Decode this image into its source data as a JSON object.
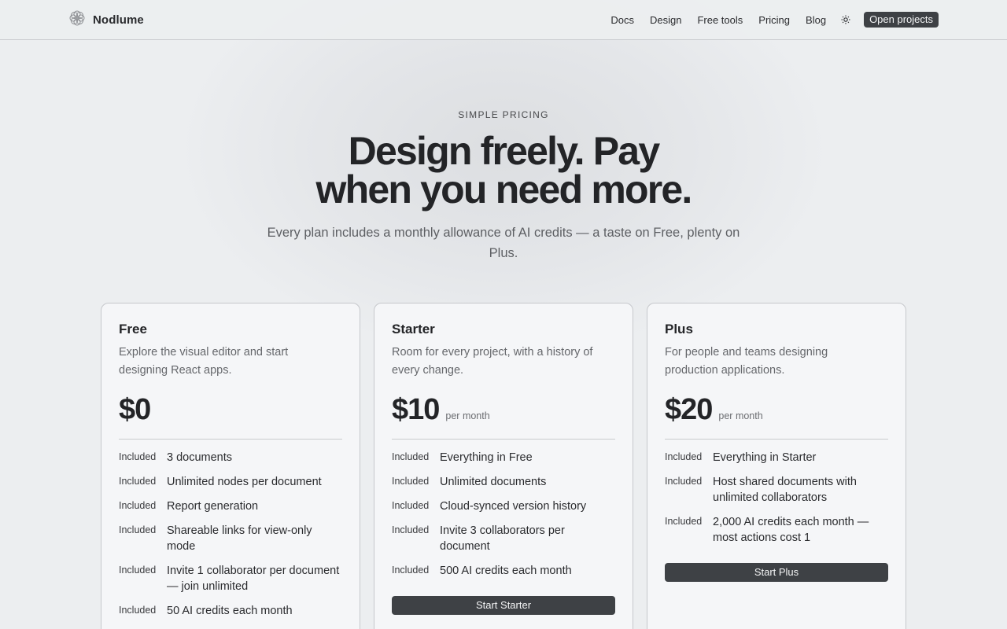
{
  "brand": {
    "name": "Nodlume",
    "logo_icon": "flower-logo-icon"
  },
  "nav": {
    "links": [
      "Docs",
      "Design",
      "Free tools",
      "Pricing",
      "Blog"
    ],
    "theme_icon": "sun-icon",
    "cta": "Open projects"
  },
  "hero": {
    "eyebrow": "SIMPLE PRICING",
    "headline_line1": "Design freely. Pay",
    "headline_line2": "when you need more.",
    "subhead": "Every plan includes a monthly allowance of AI credits — a taste on Free, plenty on Plus."
  },
  "plans": [
    {
      "name": "Free",
      "description": "Explore the visual editor and start designing React apps.",
      "price": "$0",
      "period": "",
      "features": [
        {
          "tag": "Included",
          "text": "3 documents"
        },
        {
          "tag": "Included",
          "text": "Unlimited nodes per document"
        },
        {
          "tag": "Included",
          "text": "Report generation"
        },
        {
          "tag": "Included",
          "text": "Shareable links for view-only mode"
        },
        {
          "tag": "Included",
          "text": "Invite 1 collaborator per document — join unlimited"
        },
        {
          "tag": "Included",
          "text": "50 AI credits each month"
        }
      ],
      "button": ""
    },
    {
      "name": "Starter",
      "description": "Room for every project, with a history of every change.",
      "price": "$10",
      "period": "per month",
      "features": [
        {
          "tag": "Included",
          "text": "Everything in Free"
        },
        {
          "tag": "Included",
          "text": "Unlimited documents"
        },
        {
          "tag": "Included",
          "text": "Cloud-synced version history"
        },
        {
          "tag": "Included",
          "text": "Invite 3 collaborators per document"
        },
        {
          "tag": "Included",
          "text": "500 AI credits each month"
        }
      ],
      "button": "Start Starter"
    },
    {
      "name": "Plus",
      "description": "For people and teams designing production applications.",
      "price": "$20",
      "period": "per month",
      "features": [
        {
          "tag": "Included",
          "text": "Everything in Starter"
        },
        {
          "tag": "Included",
          "text": "Host shared documents with unlimited collaborators"
        },
        {
          "tag": "Included",
          "text": "2,000 AI credits each month — most actions cost 1"
        }
      ],
      "button": "Start Plus"
    }
  ]
}
